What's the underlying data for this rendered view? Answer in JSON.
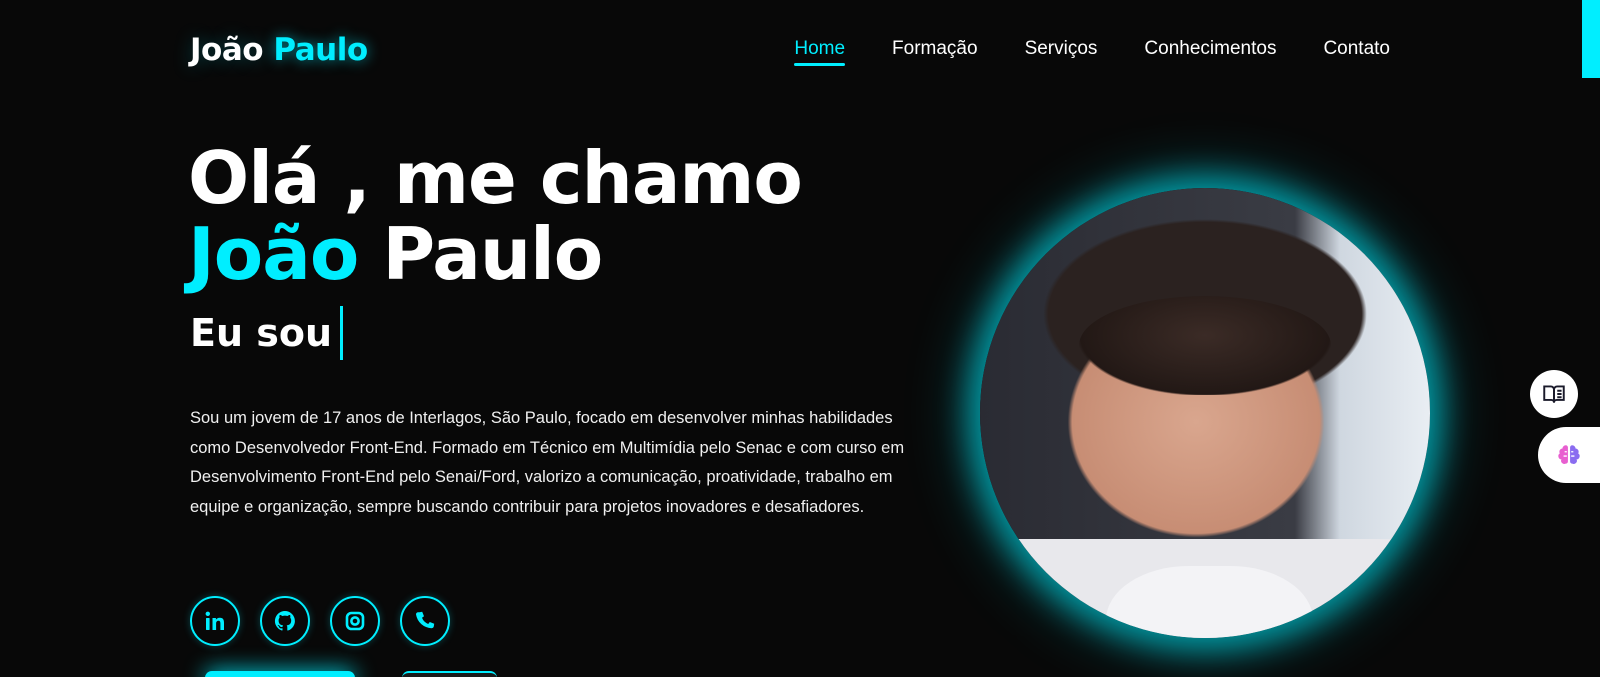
{
  "logo": {
    "first": "João",
    "last": "Paulo"
  },
  "nav": [
    {
      "label": "Home",
      "active": true
    },
    {
      "label": "Formação",
      "active": false
    },
    {
      "label": "Serviços",
      "active": false
    },
    {
      "label": "Conhecimentos",
      "active": false
    },
    {
      "label": "Contato",
      "active": false
    }
  ],
  "hero": {
    "line1": "Olá , me chamo",
    "name_first": "João",
    "name_last": "Paulo",
    "eu_sou": "Eu sou",
    "bio": "Sou um jovem de 17 anos de Interlagos, São Paulo, focado em desenvolver minhas habilidades como Desenvolvedor Front-End. Formado em Técnico em Multimídia pelo Senac e com curso em Desenvolvimento Front-End pelo Senai/Ford, valorizo a comunicação, proatividade, trabalho em equipe e organização, sempre buscando contribuir para projetos inovadores e desafiadores."
  },
  "socials": [
    {
      "icon": "linkedin-icon"
    },
    {
      "icon": "github-icon"
    },
    {
      "icon": "instagram-icon"
    },
    {
      "icon": "phone-icon"
    }
  ],
  "side_buttons": [
    {
      "icon": "book-icon"
    },
    {
      "icon": "brain-icon"
    }
  ],
  "colors": {
    "accent": "#00eeff",
    "background": "#080808",
    "text": "#ffffff"
  }
}
